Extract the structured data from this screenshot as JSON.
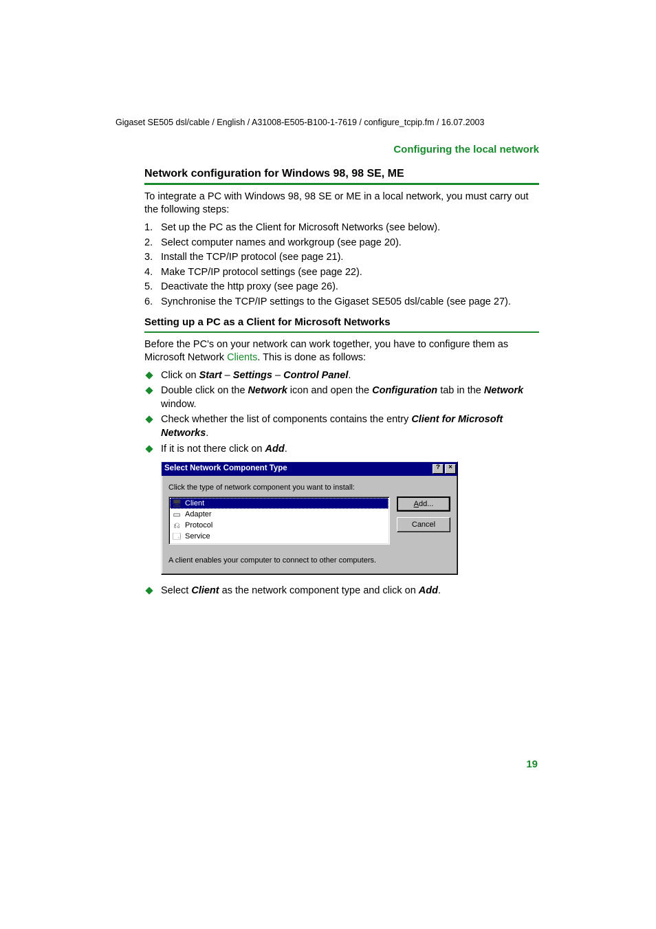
{
  "header_meta": "Gigaset SE505 dsl/cable / English / A31008-E505-B100-1-7619 / configure_tcpip.fm / 16.07.2003",
  "section_top": "Configuring the local network",
  "h1": "Network configuration for Windows 98, 98 SE, ME",
  "intro": "To integrate a PC with Windows 98, 98 SE or ME in a local network, you must carry out the following steps:",
  "steps": [
    "Set up the PC as the Client for Microsoft Networks (see below).",
    "Select computer names and workgroup (see page 20).",
    "Install the TCP/IP protocol (see page 21).",
    "Make TCP/IP protocol settings (see page 22).",
    "Deactivate the http proxy (see page 26).",
    "Synchronise the TCP/IP settings to the Gigaset SE505 dsl/cable (see page 27)."
  ],
  "h2": "Setting up a PC as a Client for Microsoft Networks",
  "para2_before": "Before the PC's on your network can work together, you have to configure them as Microsoft Network ",
  "para2_link": "Clients",
  "para2_after": ". This is done as follows:",
  "b1": {
    "pre": "Click on ",
    "s1": "Start",
    "d1": " – ",
    "s2": "Settings",
    "d2": " – ",
    "s3": "Control Panel",
    "post": "."
  },
  "b2": {
    "pre": "Double click on the ",
    "s1": "Network",
    "mid": " icon and open the ",
    "s2": "Configuration",
    "mid2": " tab in the ",
    "s3": "Network",
    "post": " window."
  },
  "b3": {
    "pre": "Check whether the list of components contains the entry ",
    "s1": "Client for Microsoft Networks",
    "post": "."
  },
  "b4": {
    "pre": "If it is not there click on ",
    "s1": "Add",
    "post": "."
  },
  "dialog": {
    "title": "Select Network Component Type",
    "prompt": "Click the type of network component you want to install:",
    "items": [
      {
        "label": "Client",
        "icon": "🖥",
        "selected": true
      },
      {
        "label": "Adapter",
        "icon": "▭",
        "selected": false
      },
      {
        "label": "Protocol",
        "icon": "⎌",
        "selected": false
      },
      {
        "label": "Service",
        "icon": "🗔",
        "selected": false
      }
    ],
    "add_btn_pre": "",
    "add_btn_ul": "A",
    "add_btn_post": "dd...",
    "cancel_btn": "Cancel",
    "desc": "A client enables your computer to connect to other computers."
  },
  "b5": {
    "pre": "Select ",
    "s1": "Client",
    "mid": " as the network component type and click on ",
    "s2": "Add",
    "post": "."
  },
  "page_number": "19"
}
